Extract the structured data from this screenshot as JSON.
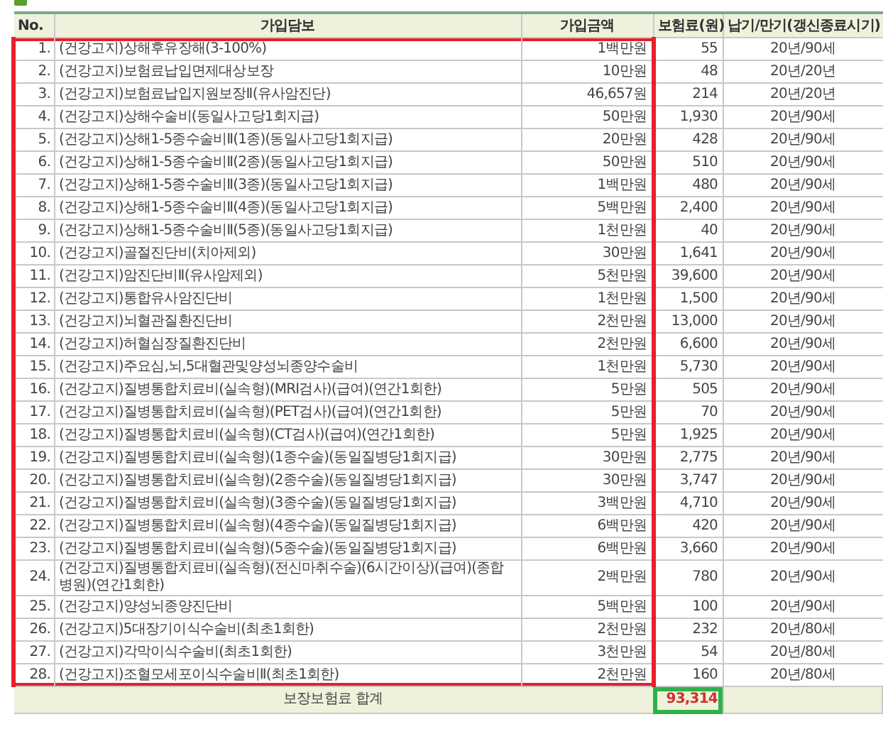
{
  "table": {
    "columns": [
      "No.",
      "가입담보",
      "가입금액",
      "보험료(원)",
      "납기/만기(갱신종료시기)"
    ],
    "rows": [
      {
        "no": "1.",
        "coverage": "(건강고지)상해후유장해(3-100%)",
        "amount": "1백만원",
        "premium": "55",
        "term": "20년/90세",
        "highlighted": true
      },
      {
        "no": "2.",
        "coverage": "(건강고지)보험료납입면제대상보장",
        "amount": "10만원",
        "premium": "48",
        "term": "20년/20년",
        "highlighted": true
      },
      {
        "no": "3.",
        "coverage": "(건강고지)보험료납입지원보장Ⅱ(유사암진단)",
        "amount": "46,657원",
        "premium": "214",
        "term": "20년/20년",
        "highlighted": true
      },
      {
        "no": "4.",
        "coverage": "(건강고지)상해수술비(동일사고당1회지급)",
        "amount": "50만원",
        "premium": "1,930",
        "term": "20년/90세",
        "highlighted": true
      },
      {
        "no": "5.",
        "coverage": "(건강고지)상해1-5종수술비Ⅱ(1종)(동일사고당1회지급)",
        "amount": "20만원",
        "premium": "428",
        "term": "20년/90세",
        "highlighted": true
      },
      {
        "no": "6.",
        "coverage": "(건강고지)상해1-5종수술비Ⅱ(2종)(동일사고당1회지급)",
        "amount": "50만원",
        "premium": "510",
        "term": "20년/90세",
        "highlighted": true
      },
      {
        "no": "7.",
        "coverage": "(건강고지)상해1-5종수술비Ⅱ(3종)(동일사고당1회지급)",
        "amount": "1백만원",
        "premium": "480",
        "term": "20년/90세",
        "highlighted": true
      },
      {
        "no": "8.",
        "coverage": "(건강고지)상해1-5종수술비Ⅱ(4종)(동일사고당1회지급)",
        "amount": "5백만원",
        "premium": "2,400",
        "term": "20년/90세",
        "highlighted": true
      },
      {
        "no": "9.",
        "coverage": "(건강고지)상해1-5종수술비Ⅱ(5종)(동일사고당1회지급)",
        "amount": "1천만원",
        "premium": "40",
        "term": "20년/90세",
        "highlighted": true
      },
      {
        "no": "10.",
        "coverage": "(건강고지)골절진단비(치아제외)",
        "amount": "30만원",
        "premium": "1,641",
        "term": "20년/90세",
        "highlighted": true
      },
      {
        "no": "11.",
        "coverage": "(건강고지)암진단비Ⅱ(유사암제외)",
        "amount": "5천만원",
        "premium": "39,600",
        "term": "20년/90세",
        "highlighted": true
      },
      {
        "no": "12.",
        "coverage": "(건강고지)통합유사암진단비",
        "amount": "1천만원",
        "premium": "1,500",
        "term": "20년/90세",
        "highlighted": true
      },
      {
        "no": "13.",
        "coverage": "(건강고지)뇌혈관질환진단비",
        "amount": "2천만원",
        "premium": "13,000",
        "term": "20년/90세",
        "highlighted": true
      },
      {
        "no": "14.",
        "coverage": "(건강고지)허혈심장질환진단비",
        "amount": "2천만원",
        "premium": "6,600",
        "term": "20년/90세",
        "highlighted": true
      },
      {
        "no": "15.",
        "coverage": "(건강고지)주요심,뇌,5대혈관및양성뇌종양수술비",
        "amount": "1천만원",
        "premium": "5,730",
        "term": "20년/90세",
        "highlighted": true
      },
      {
        "no": "16.",
        "coverage": "(건강고지)질병통합치료비(실속형)(MRI검사)(급여)(연간1회한)",
        "amount": "5만원",
        "premium": "505",
        "term": "20년/90세",
        "highlighted": true
      },
      {
        "no": "17.",
        "coverage": "(건강고지)질병통합치료비(실속형)(PET검사)(급여)(연간1회한)",
        "amount": "5만원",
        "premium": "70",
        "term": "20년/90세",
        "highlighted": true
      },
      {
        "no": "18.",
        "coverage": "(건강고지)질병통합치료비(실속형)(CT검사)(급여)(연간1회한)",
        "amount": "5만원",
        "premium": "1,925",
        "term": "20년/90세",
        "highlighted": true
      },
      {
        "no": "19.",
        "coverage": "(건강고지)질병통합치료비(실속형)(1종수술)(동일질병당1회지급)",
        "amount": "30만원",
        "premium": "2,775",
        "term": "20년/90세",
        "highlighted": true
      },
      {
        "no": "20.",
        "coverage": "(건강고지)질병통합치료비(실속형)(2종수술)(동일질병당1회지급)",
        "amount": "30만원",
        "premium": "3,747",
        "term": "20년/90세",
        "highlighted": true
      },
      {
        "no": "21.",
        "coverage": "(건강고지)질병통합치료비(실속형)(3종수술)(동일질병당1회지급)",
        "amount": "3백만원",
        "premium": "4,710",
        "term": "20년/90세",
        "highlighted": true
      },
      {
        "no": "22.",
        "coverage": "(건강고지)질병통합치료비(실속형)(4종수술)(동일질병당1회지급)",
        "amount": "6백만원",
        "premium": "420",
        "term": "20년/90세",
        "highlighted": true
      },
      {
        "no": "23.",
        "coverage": "(건강고지)질병통합치료비(실속형)(5종수술)(동일질병당1회지급)",
        "amount": "6백만원",
        "premium": "3,660",
        "term": "20년/90세",
        "highlighted": true
      },
      {
        "no": "24.",
        "coverage": "(건강고지)질병통합치료비(실속형)(전신마취수술)(6시간이상)(급여)(종합병원)(연간1회한)",
        "amount": "2백만원",
        "premium": "780",
        "term": "20년/90세",
        "highlighted": true
      },
      {
        "no": "25.",
        "coverage": "(건강고지)양성뇌종양진단비",
        "amount": "5백만원",
        "premium": "100",
        "term": "20년/90세",
        "highlighted": true
      },
      {
        "no": "26.",
        "coverage": "(건강고지)5대장기이식수술비(최초1회한)",
        "amount": "2천만원",
        "premium": "232",
        "term": "20년/80세",
        "highlighted": true
      },
      {
        "no": "27.",
        "coverage": "(건강고지)각막이식수술비(최초1회한)",
        "amount": "3천만원",
        "premium": "54",
        "term": "20년/80세",
        "highlighted": true
      },
      {
        "no": "28.",
        "coverage": "(건강고지)조혈모세포이식수술비Ⅱ(최초1회한)",
        "amount": "2천만원",
        "premium": "160",
        "term": "20년/80세",
        "highlighted": true
      }
    ],
    "total": {
      "label": "보장보험료 합계",
      "value": "93,314",
      "highlighted": true
    }
  }
}
